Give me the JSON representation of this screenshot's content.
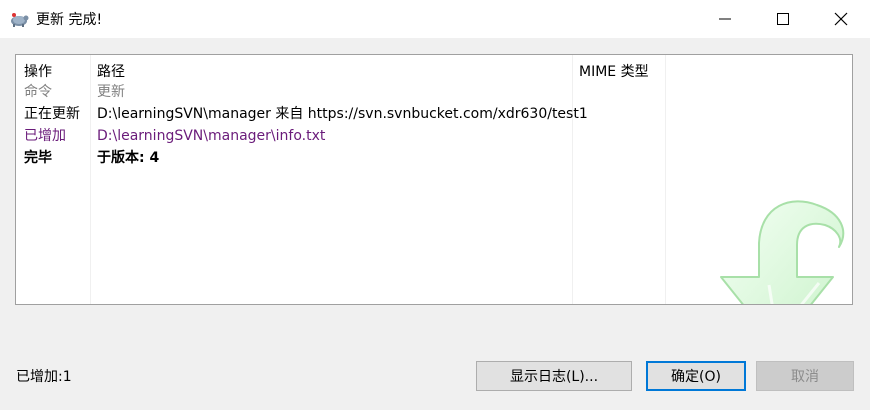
{
  "window": {
    "title": "更新 完成!",
    "controls": {
      "minimize": "minimize",
      "maximize": "maximize",
      "close": "close"
    }
  },
  "list": {
    "columns": [
      "操作",
      "路径",
      "MIME 类型"
    ],
    "rows": [
      {
        "action": "命令",
        "path": "更新",
        "style": "gray"
      },
      {
        "action": "正在更新",
        "path": "D:\\learningSVN\\manager 来自 https://svn.svnbucket.com/xdr630/test1",
        "style": "normal"
      },
      {
        "action": "已增加",
        "path": "D:\\learningSVN\\manager\\info.txt",
        "style": "purple"
      },
      {
        "action": "完毕",
        "path": "于版本: 4",
        "style": "bold"
      }
    ],
    "decoration_icon": "green-update-arrow-icon"
  },
  "status": {
    "text": "已增加:1"
  },
  "buttons": {
    "show_log": "显示日志(L)...",
    "ok": "确定(O)",
    "cancel": "取消"
  },
  "colors": {
    "added_text": "#6a1b7a",
    "command_text": "#808080",
    "focus_border": "#0078d7"
  }
}
